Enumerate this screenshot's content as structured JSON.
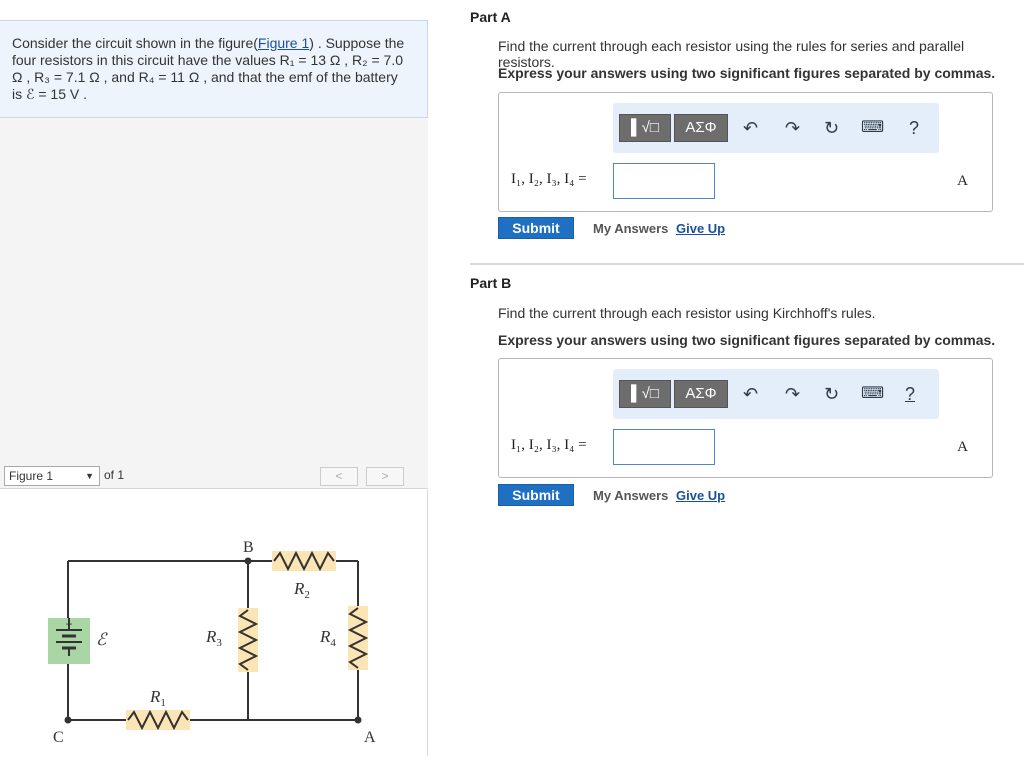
{
  "problem": {
    "text_before_link": "Consider the circuit shown in the figure(",
    "link": "Figure 1",
    "line_rest": ") . Suppose the",
    "line2": "four resistors in this circuit have the values R₁ = 13 Ω , R₂ = 7.0",
    "line3": "Ω , R₃ = 7.1 Ω , and R₄ = 11 Ω , and that the emf of the battery",
    "line4": "is ℰ = 15 V ."
  },
  "figure_nav": {
    "selected": "Figure 1",
    "of_label": "of 1",
    "prev": "<",
    "next": ">"
  },
  "circuit": {
    "labels": {
      "B": "B",
      "C": "C",
      "A": "A",
      "R1": "R",
      "R1_sub": "1",
      "R2": "R",
      "R2_sub": "2",
      "R3": "R",
      "R3_sub": "3",
      "R4": "R",
      "R4_sub": "4",
      "emf": "ℰ",
      "plus": "+"
    },
    "colors": {
      "resistor_bg": "#fbe5b5",
      "battery_bg": "#a9d6a4",
      "wire": "#333333"
    }
  },
  "part_a": {
    "label": "Part A",
    "instruction": "Find the current through each resistor using the rules for series and parallel resistors.",
    "express": "Express your answers using two significant figures separated by commas.",
    "toolbar": {
      "templates": "▌√□",
      "greek": "ΑΣΦ",
      "undo": "undo-icon",
      "redo": "redo-icon",
      "reset": "reset-icon",
      "keyboard": "keyboard-icon",
      "help": "?"
    },
    "equation_label": "I₁, I₂, I₃, I₄ =",
    "input_value": "",
    "unit": "A",
    "submit": "Submit",
    "my_answers": "My Answers",
    "give_up": "Give Up"
  },
  "part_b": {
    "label": "Part B",
    "instruction": "Find the current through each resistor using Kirchhoff's rules.",
    "express": "Express your answers using two significant figures separated by commas.",
    "toolbar": {
      "templates": "▌√□",
      "greek": "ΑΣΦ",
      "undo": "undo-icon",
      "redo": "redo-icon",
      "reset": "reset-icon",
      "keyboard": "keyboard-icon",
      "help": "?"
    },
    "equation_label": "I₁, I₂, I₃, I₄ =",
    "input_value": "",
    "unit": "A",
    "submit": "Submit",
    "my_answers": "My Answers",
    "give_up": "Give Up"
  },
  "colors": {
    "accent": "#1f6fc2",
    "link": "#1a4fa0",
    "toolbar_bg": "#e4eefb",
    "panel_bg": "#eef4fb"
  }
}
